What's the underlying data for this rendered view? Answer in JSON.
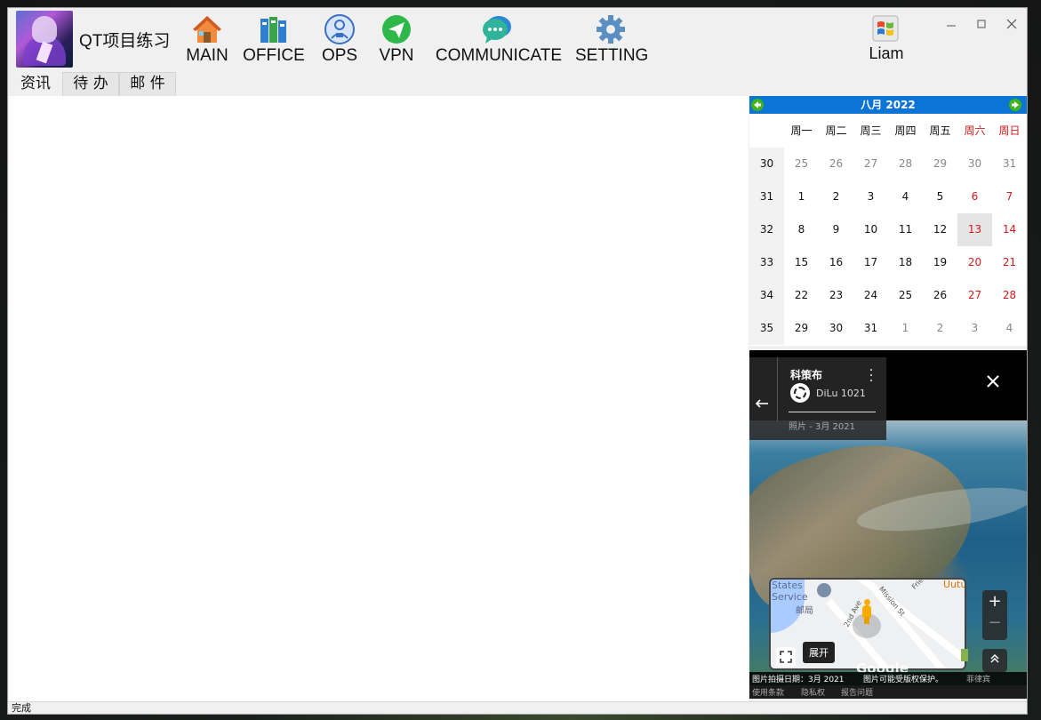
{
  "app": {
    "title": "QT项目练习",
    "user": "Liam",
    "status": "完成"
  },
  "nav": [
    {
      "label": "MAIN",
      "icon": "home-icon"
    },
    {
      "label": "OFFICE",
      "icon": "books-icon"
    },
    {
      "label": "OPS",
      "icon": "ops-robot-icon"
    },
    {
      "label": "VPN",
      "icon": "vpn-send-icon"
    },
    {
      "label": "COMMUNICATE",
      "icon": "chat-bubble-icon"
    },
    {
      "label": "SETTING",
      "icon": "gear-icon"
    }
  ],
  "tabs": [
    {
      "label": "资讯",
      "active": true
    },
    {
      "label": "待 办",
      "active": false
    },
    {
      "label": "邮 件",
      "active": false
    }
  ],
  "calendar": {
    "title": "八月 2022",
    "weekdays": [
      "周一",
      "周二",
      "周三",
      "周四",
      "周五",
      "周六",
      "周日"
    ],
    "rows": [
      {
        "week": "30",
        "days": [
          {
            "d": "25",
            "dim": true
          },
          {
            "d": "26",
            "dim": true
          },
          {
            "d": "27",
            "dim": true
          },
          {
            "d": "28",
            "dim": true
          },
          {
            "d": "29",
            "dim": true
          },
          {
            "d": "30",
            "dim": true
          },
          {
            "d": "31",
            "dim": true
          }
        ]
      },
      {
        "week": "31",
        "days": [
          {
            "d": "1"
          },
          {
            "d": "2"
          },
          {
            "d": "3"
          },
          {
            "d": "4"
          },
          {
            "d": "5"
          },
          {
            "d": "6"
          },
          {
            "d": "7"
          }
        ]
      },
      {
        "week": "32",
        "days": [
          {
            "d": "8"
          },
          {
            "d": "9"
          },
          {
            "d": "10"
          },
          {
            "d": "11"
          },
          {
            "d": "12"
          },
          {
            "d": "13",
            "today": true
          },
          {
            "d": "14"
          }
        ]
      },
      {
        "week": "33",
        "days": [
          {
            "d": "15"
          },
          {
            "d": "16"
          },
          {
            "d": "17"
          },
          {
            "d": "18"
          },
          {
            "d": "19"
          },
          {
            "d": "20"
          },
          {
            "d": "21"
          }
        ]
      },
      {
        "week": "34",
        "days": [
          {
            "d": "22"
          },
          {
            "d": "23"
          },
          {
            "d": "24"
          },
          {
            "d": "25"
          },
          {
            "d": "26"
          },
          {
            "d": "27"
          },
          {
            "d": "28"
          }
        ]
      },
      {
        "week": "35",
        "days": [
          {
            "d": "29"
          },
          {
            "d": "30"
          },
          {
            "d": "31"
          },
          {
            "d": "1",
            "dim": true
          },
          {
            "d": "2",
            "dim": true
          },
          {
            "d": "3",
            "dim": true
          },
          {
            "d": "4",
            "dim": true
          }
        ]
      }
    ]
  },
  "photo": {
    "place": "科策布",
    "author": "DiLu 1021",
    "date": "照片 - 3月 2021",
    "expand_tooltip": "展开",
    "map": {
      "label1": "States",
      "label2": "Service",
      "label3": "邮局",
      "street1": "2nd Ave",
      "street2": "Mission St",
      "street3": "Frie",
      "orange": "Uutu"
    },
    "watermark": "Google",
    "footer_date": "图片拍摄日期：3月 2021",
    "footer_copyright": "图片可能受版权保护。",
    "footer_right": "菲律宾",
    "links": [
      "使用条款",
      "隐私权",
      "报告问题"
    ]
  }
}
